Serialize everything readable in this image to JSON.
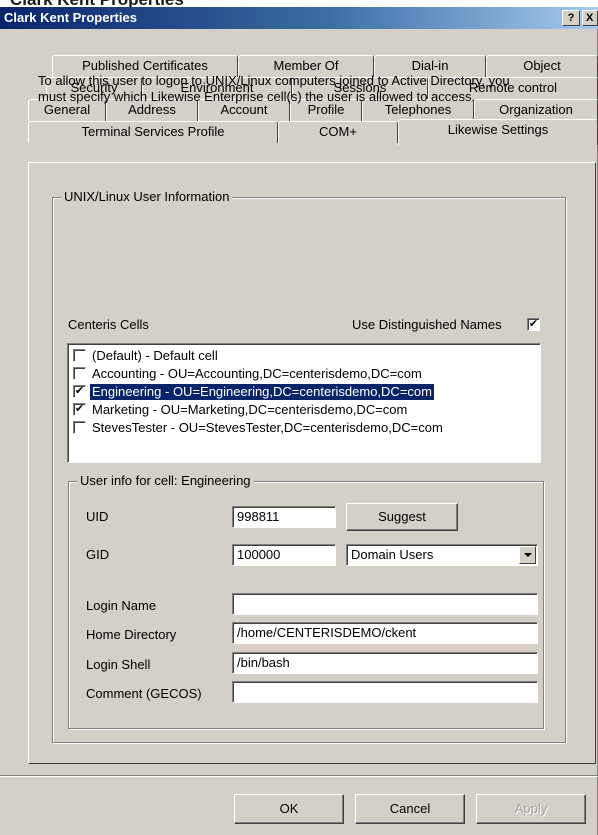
{
  "top_strip_text": "Clark Kent Properties",
  "window": {
    "title": "Clark Kent Properties",
    "help_btn": "?",
    "close_btn": "X"
  },
  "tabs": {
    "row1": [
      "Published Certificates",
      "Member Of",
      "Dial-in",
      "Object"
    ],
    "row2": [
      "Security",
      "Environment",
      "Sessions",
      "Remote control"
    ],
    "row3": [
      "General",
      "Address",
      "Account",
      "Profile",
      "Telephones",
      "Organization"
    ],
    "row4": [
      "Terminal Services Profile",
      "COM+",
      "Likewise Settings"
    ],
    "active": "Likewise Settings"
  },
  "unix_group": {
    "title": "UNIX/Linux User Information",
    "description": "To allow this user to logon to UNIX/Linux computers joined to Active Directory, you must specify which Likewise Enterprise cell(s) the user is allowed to access."
  },
  "cells": {
    "label": "Centeris Cells",
    "use_dn_label": "Use Distinguished Names",
    "use_dn_checked": true,
    "items": [
      {
        "text": "(Default) - Default cell",
        "checked": false,
        "selected": false
      },
      {
        "text": "Accounting - OU=Accounting,DC=centerisdemo,DC=com",
        "checked": false,
        "selected": false
      },
      {
        "text": "Engineering - OU=Engineering,DC=centerisdemo,DC=com",
        "checked": true,
        "selected": true
      },
      {
        "text": "Marketing - OU=Marketing,DC=centerisdemo,DC=com",
        "checked": true,
        "selected": false
      },
      {
        "text": "StevesTester - OU=StevesTester,DC=centerisdemo,DC=com",
        "checked": false,
        "selected": false
      }
    ]
  },
  "user_info": {
    "title": "User info for cell: Engineering",
    "uid_label": "UID",
    "uid_value": "998811",
    "suggest_label": "Suggest",
    "gid_label": "GID",
    "gid_value": "100000",
    "group_select": "Domain Users",
    "login_name_label": "Login Name",
    "login_name_value": "",
    "home_dir_label": "Home Directory",
    "home_dir_value": "/home/CENTERISDEMO/ckent",
    "login_shell_label": "Login Shell",
    "login_shell_value": "/bin/bash",
    "comment_label": "Comment (GECOS)",
    "comment_value": ""
  },
  "buttons": {
    "ok": "OK",
    "cancel": "Cancel",
    "apply": "Apply"
  }
}
